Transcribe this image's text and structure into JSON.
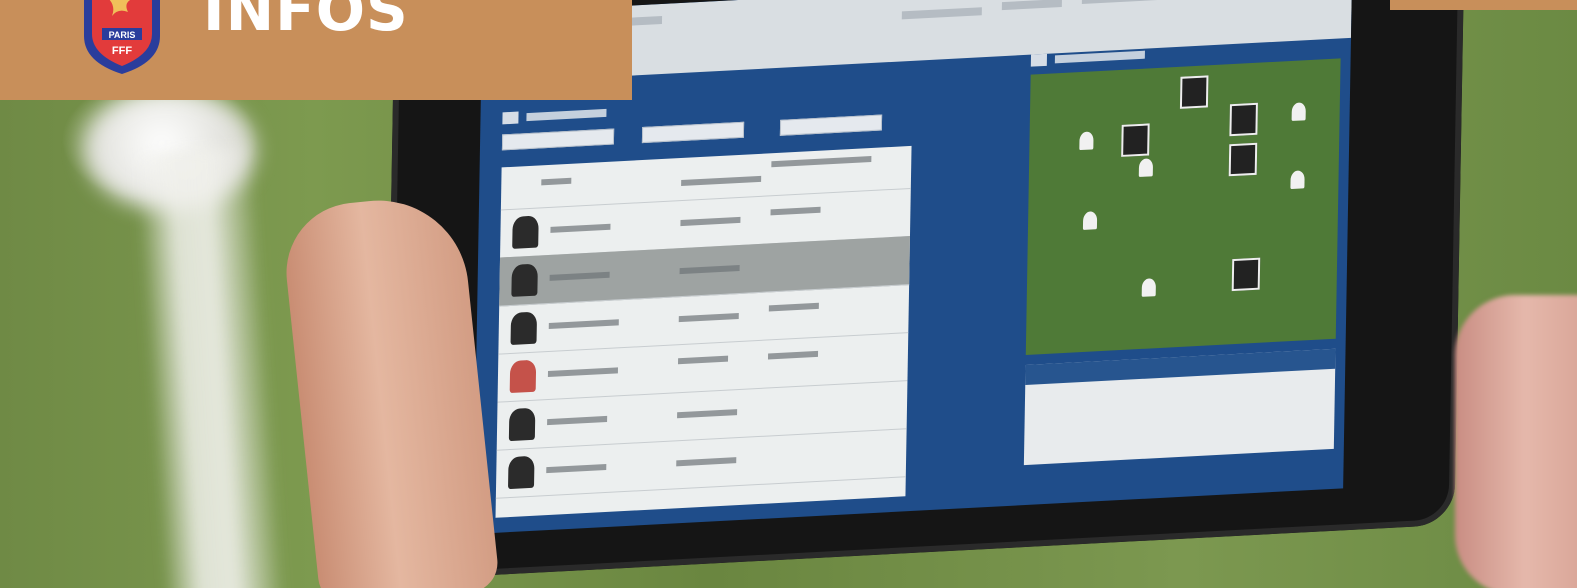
{
  "banner": {
    "title": "INFOS",
    "logo": {
      "city": "PARIS",
      "org": "FFF",
      "colors": {
        "shield_blue": "#2a3d9c",
        "shield_red": "#e23b3b",
        "rooster_gold": "#f0c05a"
      }
    },
    "background_color": "#c88f5a"
  },
  "photo": {
    "icon_semantics": [
      "tablet-icon",
      "player-icon",
      "crest-icon"
    ]
  }
}
